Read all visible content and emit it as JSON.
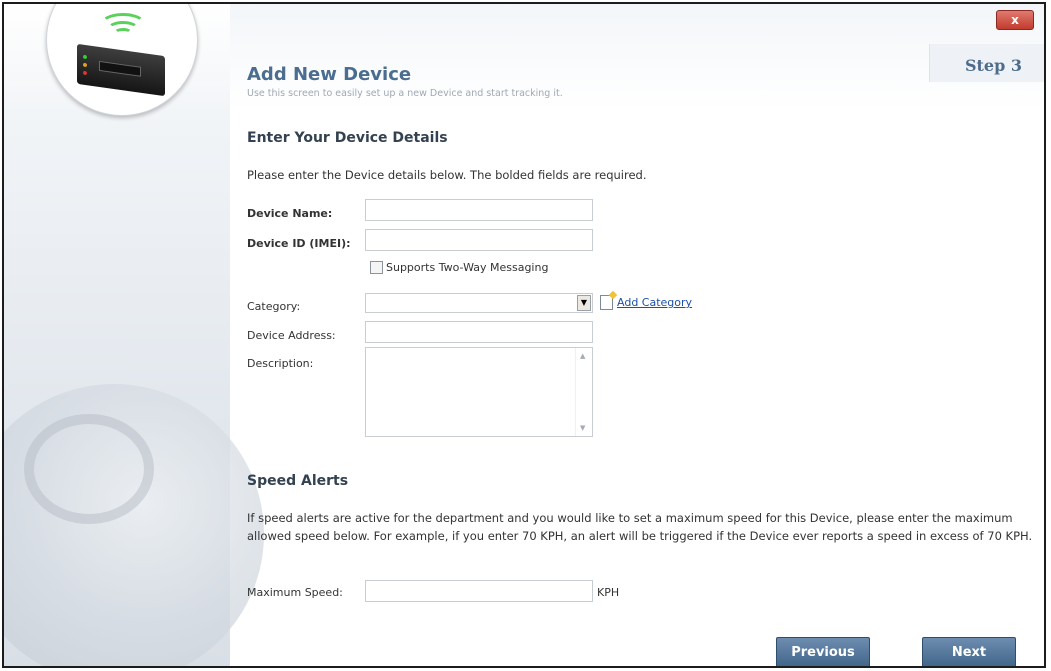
{
  "window": {
    "close_label": "x"
  },
  "header": {
    "step_label": "Step 3",
    "title": "Add New Device",
    "subtitle": "Use this screen to easily set up a new Device and start tracking it."
  },
  "device_details": {
    "heading": "Enter Your Device Details",
    "instructions": "Please enter the Device details below. The bolded fields are required.",
    "device_name": {
      "label": "Device Name:",
      "value": ""
    },
    "device_id": {
      "label": "Device ID (IMEI):",
      "value": ""
    },
    "two_way": {
      "label": "Supports Two-Way Messaging",
      "checked": false
    },
    "category": {
      "label": "Category:",
      "value": "",
      "add_label": "Add Category"
    },
    "device_address": {
      "label": "Device Address:",
      "value": ""
    },
    "description": {
      "label": "Description:",
      "value": ""
    }
  },
  "speed_alerts": {
    "heading": "Speed Alerts",
    "text": "If speed alerts are active for the department and you would like to set a maximum speed for this Device, please enter the maximum allowed speed below. For example, if you enter 70 KPH, an alert will be triggered if the Device ever reports a speed in excess of 70 KPH.",
    "max_speed": {
      "label": "Maximum Speed:",
      "value": "",
      "unit": "KPH"
    }
  },
  "buttons": {
    "previous": "Previous",
    "next": "Next"
  },
  "colors": {
    "accent": "#4b6d8f",
    "button": "#4f7398",
    "link": "#1d4fa6",
    "close": "#c23b2e"
  }
}
